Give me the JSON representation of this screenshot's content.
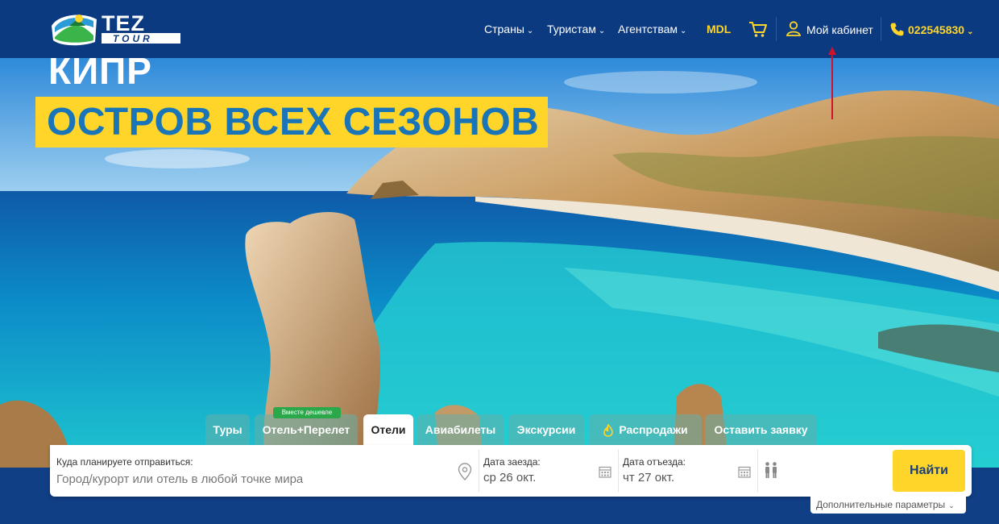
{
  "header": {
    "logo_text": "TEZ TOUR",
    "nav": [
      {
        "label": "Страны"
      },
      {
        "label": "Туристам"
      },
      {
        "label": "Агентствам"
      }
    ],
    "currency": "MDL",
    "cabinet_label": "Мой кабинет",
    "phone": "022545830"
  },
  "hero": {
    "title": "КИПР",
    "subtitle": "ОСТРОВ ВСЕХ СЕЗОНОВ"
  },
  "tabs": [
    {
      "label": "Туры",
      "active": false
    },
    {
      "label": "Отель+Перелет",
      "active": false,
      "badge": "Вместе дешевле"
    },
    {
      "label": "Отели",
      "active": true
    },
    {
      "label": "Авиабилеты",
      "active": false
    },
    {
      "label": "Экскурсии",
      "active": false
    },
    {
      "label": "Распродажи",
      "active": false,
      "icon": "flame-icon"
    },
    {
      "label": "Оставить заявку",
      "active": false
    }
  ],
  "search": {
    "destination_label": "Куда планируете отправиться:",
    "destination_placeholder": "Город/курорт или отель в любой точке мира",
    "checkin_label": "Дата заезда:",
    "checkin_value": "ср 26 окт.",
    "checkout_label": "Дата отъезда:",
    "checkout_value": "чт 27 окт.",
    "find_label": "Найти",
    "more_params": "Дополнительные параметры"
  },
  "colors": {
    "header_bg": "#0c3a80",
    "accent_yellow": "#ffd52a",
    "banner_text": "#1a74b8",
    "arrow": "#d0122a"
  }
}
